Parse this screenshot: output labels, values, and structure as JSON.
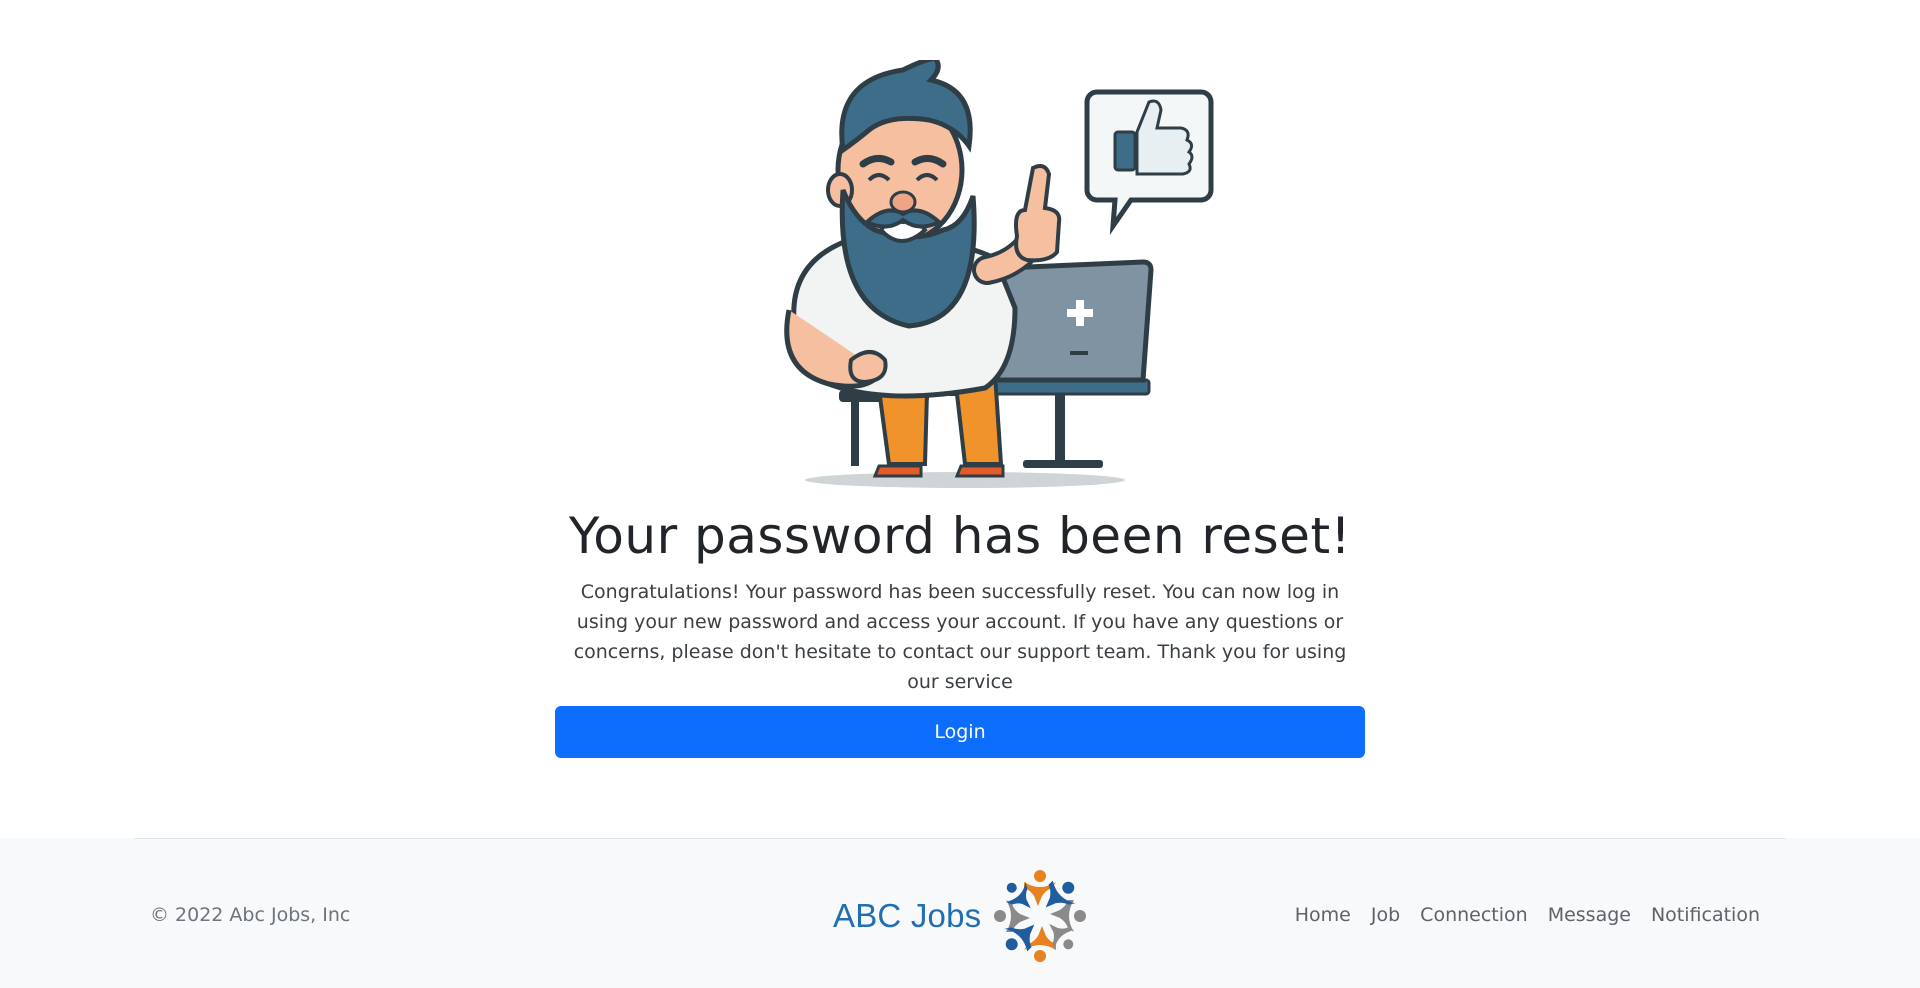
{
  "main": {
    "title": "Your password has been reset!",
    "description": "Congratulations! Your password has been successfully reset. You can now log in using your new password and access your account. If you have any questions or concerns, please don't hesitate to contact our support team. Thank you for using our service",
    "login_label": "Login",
    "illustration": "bearded-man-thumbs-up-laptop-icon"
  },
  "footer": {
    "copyright": "© 2022 Abc Jobs, Inc",
    "brand": "ABC Jobs",
    "nav": [
      "Home",
      "Job",
      "Connection",
      "Message",
      "Notification"
    ]
  },
  "colors": {
    "primary": "#0d6efd",
    "brand": "#1f6fb2",
    "footer_bg": "#f8f9fa",
    "logo_orange": "#e8821e",
    "logo_gray": "#8a8a8a"
  }
}
